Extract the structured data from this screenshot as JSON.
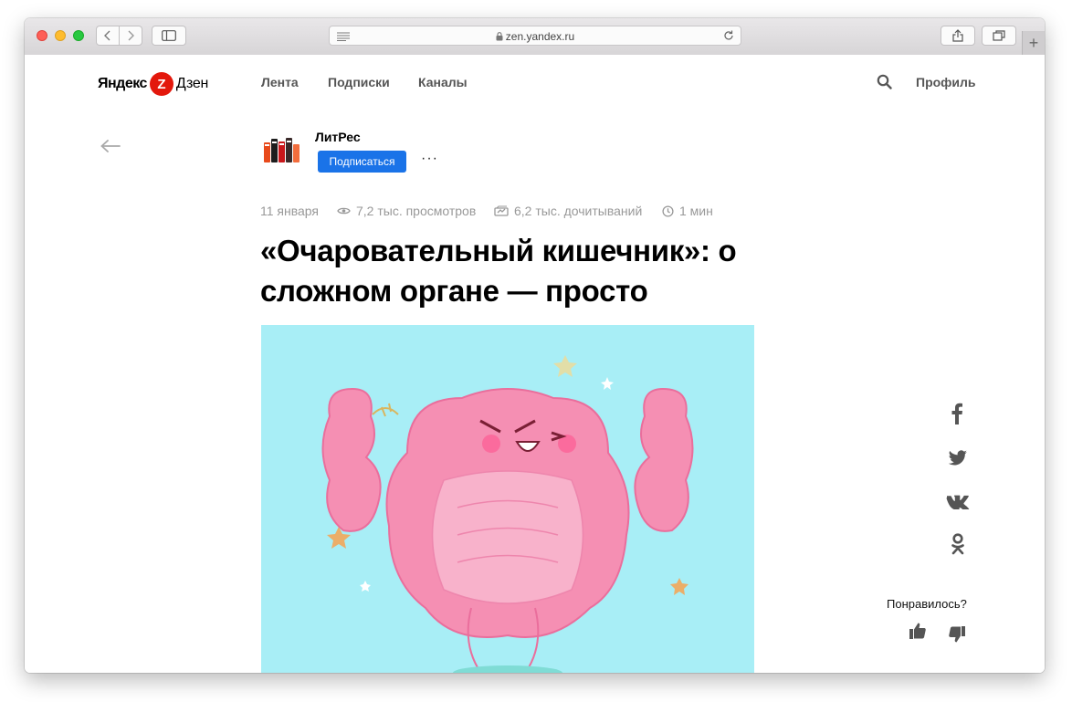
{
  "browser": {
    "url": "zen.yandex.ru"
  },
  "header": {
    "logo": {
      "yandex": "Яндекс",
      "z": "Z",
      "dzen": "Дзен"
    },
    "nav": [
      "Лента",
      "Подписки",
      "Каналы"
    ],
    "profile": "Профиль"
  },
  "channel": {
    "name": "ЛитРес",
    "subscribe_label": "Подписаться",
    "more_label": "···"
  },
  "article": {
    "date": "11 января",
    "views": "7,2 тыс. просмотров",
    "reads": "6,2 тыс. дочитываний",
    "read_time": "1 мин",
    "title": "«Очаровательный кишечник»: о сложном органе — просто"
  },
  "sidebar": {
    "share": [
      "facebook-icon",
      "twitter-icon",
      "vk-icon",
      "odnoklassniki-icon"
    ],
    "liked_question": "Понравилось?"
  },
  "colors": {
    "accent": "#1a73e8",
    "logo_red": "#e3180c",
    "hero_bg": "#a8eef6",
    "hero_pink": "#f58fb3"
  }
}
